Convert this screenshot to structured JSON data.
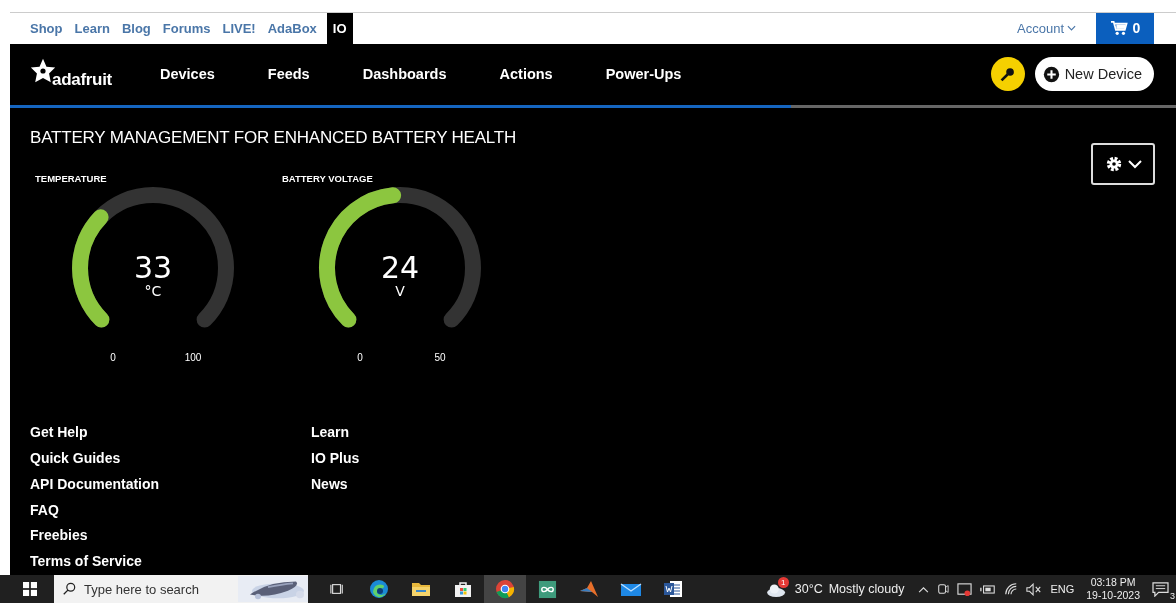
{
  "top_nav": {
    "links": [
      {
        "label": "Shop",
        "selected": false
      },
      {
        "label": "Learn",
        "selected": false
      },
      {
        "label": "Blog",
        "selected": false
      },
      {
        "label": "Forums",
        "selected": false
      },
      {
        "label": "LIVE!",
        "selected": false
      },
      {
        "label": "AdaBox",
        "selected": false
      },
      {
        "label": "IO",
        "selected": true
      }
    ],
    "account": "Account",
    "cart_count": "0"
  },
  "header": {
    "logo": "adafruit",
    "nav": [
      "Devices",
      "Feeds",
      "Dashboards",
      "Actions",
      "Power-Ups"
    ],
    "new_device": "New Device",
    "progress": {
      "level": 0.67
    }
  },
  "dashboard": {
    "title": "BATTERY MANAGEMENT FOR ENHANCED BATTERY HEALTH",
    "gauges": [
      {
        "label": "TEMPERATURE",
        "value": "33",
        "unit": "°C",
        "min": "0",
        "max": "100"
      },
      {
        "label": "BATTERY VOLTAGE",
        "value": "24",
        "unit": "V",
        "min": "0",
        "max": "50"
      }
    ]
  },
  "footer": {
    "columns": [
      [
        "Get Help",
        "Quick Guides",
        "API Documentation",
        "FAQ",
        "Freebies",
        "Terms of Service"
      ],
      [
        "Learn",
        "IO Plus",
        "News"
      ]
    ]
  },
  "taskbar": {
    "search": {
      "placeholder": "Type here to search"
    },
    "apps": [
      {
        "kind": "taskview",
        "selected": false
      },
      {
        "kind": "edge",
        "selected": false
      },
      {
        "kind": "folder",
        "selected": false
      },
      {
        "kind": "store",
        "selected": false
      },
      {
        "kind": "chrome",
        "selected": true
      },
      {
        "kind": "arduino",
        "selected": false
      },
      {
        "kind": "matlab",
        "selected": false
      },
      {
        "kind": "mail",
        "selected": false
      },
      {
        "kind": "word",
        "selected": false
      }
    ],
    "weather": {
      "badge": "1",
      "temp": "30°C",
      "condition": "Mostly cloudy"
    },
    "language": "ENG",
    "time": "03:18 PM",
    "date": "19-10-2023",
    "notifications": "3"
  }
}
